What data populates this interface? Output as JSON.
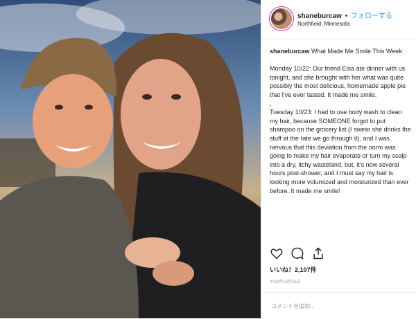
{
  "header": {
    "username": "shaneburcaw",
    "separator": "•",
    "follow_label": "フォローする",
    "location": "Northfield, Minnesota"
  },
  "caption": {
    "username": "shaneburcaw",
    "text": " What Made Me Smile This Week:\n.\nMonday 10/22: Our friend Elsa ate dinner with us tonight, and she brought with her what was quite possibly the most delicious, homemade apple pie that I've ever tasted. It made me smile.\n.\nTuesday 10/23: I had to use body wash to clean my hair, because SOMEONE forgot to put shampoo on the grocery list (I swear she drinks the stuff at the rate we go through it), and I was nervous that this deviation from the norm was going to make my hair evaporate or turn my scalp into a dry, itchy wasteland, but, it's now several hours post-shower, and I must say my hair is looking more volumized and moisturized than ever before. It made me smile!"
  },
  "actions": {
    "like_icon": "heart-icon",
    "comment_icon": "comment-icon",
    "share_icon": "share-icon"
  },
  "likes": {
    "label": "いいね！2,107件"
  },
  "date": "2018年10月26日",
  "comment_box": {
    "placeholder": "コメントを追加..."
  },
  "colors": {
    "accent": "#3897f0",
    "text": "#262626",
    "muted": "#999999",
    "border": "#efefef"
  }
}
